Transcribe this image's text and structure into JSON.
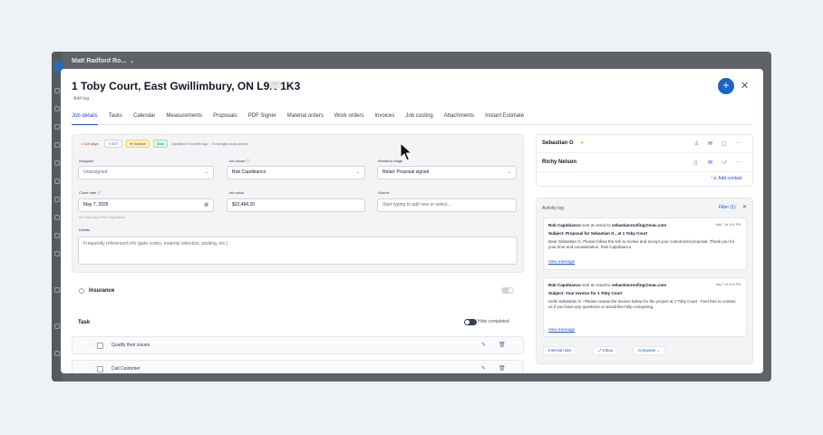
{
  "app": {
    "title": "Matt Radford Ro...",
    "title_caret": "⌄"
  },
  "modal": {
    "title": "1 Toby Court, East Gwillimbury, ON L9N 1K3",
    "more_label": "···",
    "add_tag": "Add tag",
    "fab_label": "+",
    "close_label": "✕"
  },
  "tabs": [
    "Job details",
    "Tasks",
    "Calendar",
    "Measurements",
    "Proposals",
    "PDF Signer",
    "Material orders",
    "Work orders",
    "Invoices",
    "Job costing",
    "Attachments",
    "Instant Estimate"
  ],
  "meta": {
    "days": "• 119 days",
    "count": "▯ 0/37",
    "multiple": "★ Multiple",
    "won": "Won",
    "updated": "Updated 5 months ago",
    "changes": "0 changes auto-saved"
  },
  "form": {
    "assigned_label": "Assigned",
    "assigned_value": "Unassigned",
    "owner_label": "Job owner ⓘ",
    "owner_value": "Rob Capobianco",
    "workflow_label": "Workflow stage",
    "workflow_value": "Retail: Proposal signed",
    "close_label": "Close date ⓘ",
    "close_value": "May 7, 2025",
    "close_hint": "Set manually to Rob Capobianco",
    "value_label": "Job value",
    "value_value": "$22,484.20",
    "source_label": "Source",
    "source_placeholder": "Start typing to add new or select...",
    "details_label": "Details",
    "details_placeholder": "Frequently referenced info (gate codes, material selection, parking, etc.)"
  },
  "insurance": {
    "label": "Insurance"
  },
  "task": {
    "title": "Task",
    "hide_completed": "Hide completed",
    "items": [
      "Qualify their issues",
      "Call Customer"
    ]
  },
  "contacts": {
    "items": [
      {
        "name": "Sebastian G",
        "star": "★"
      },
      {
        "name": "Richy Nelson"
      }
    ],
    "add_label": "Add contact"
  },
  "activity": {
    "title": "Activity log",
    "filter": "Filter (1)",
    "close": "✕",
    "emails": [
      {
        "from_name": "Rob Capobianco",
        "from_mid": " sent an email to ",
        "from_to": "sebastianroofing@mac.com",
        "time": "May 7 at 4:41 PM",
        "subject": "Subject: Proposal for Sebastian G , at 1 Toby Court",
        "body": "Dear Sebastian G, Please follow the link to review and accept your customized proposal. Thank you for your time and consideration. Rob Capobianco",
        "link": "View message"
      },
      {
        "from_name": "Rob Capobianco",
        "from_mid": " sent an email to ",
        "from_to": "sebastianroofing@mac.com",
        "time": "May 7 at 4:03 PM",
        "subject": "Subject: Your Invoice for 1 Toby Court",
        "body": "Hello Sebastian G ! Please review the invoice below for the project at 1 Toby Court . Feel free to contact us if you have any questions or would like help comparing",
        "link": "View message"
      }
    ],
    "buttons": {
      "internal_note": "Internal note",
      "inbox": "⤢ Inbox",
      "compose": "Compose ⌄"
    }
  },
  "colors": {
    "accent": "#1d63c4",
    "link": "#1d4ed8",
    "backdrop": "#5f6368",
    "page_bg": "#eef2f7"
  }
}
